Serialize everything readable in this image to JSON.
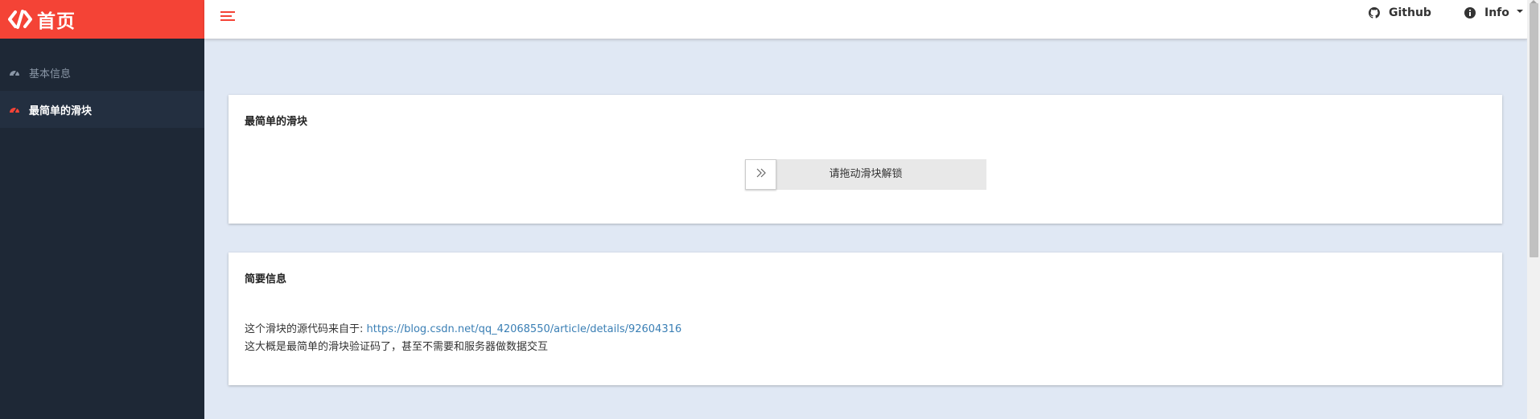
{
  "brand": {
    "title": "首页",
    "color": "#f44336"
  },
  "sidebar": {
    "items": [
      {
        "label": "基本信息",
        "icon": "dashboard-icon",
        "active": false
      },
      {
        "label": "最简单的滑块",
        "icon": "dashboard-icon",
        "active": true
      }
    ]
  },
  "topbar": {
    "menu_icon": "hamburger-icon",
    "github_label": "Github",
    "info_label": "Info"
  },
  "slider_card": {
    "title": "最简单的滑块",
    "slider_text": "请拖动滑块解锁",
    "handle_icon": "double-chevron-right-icon"
  },
  "info_card": {
    "title": "简要信息",
    "source_prefix": "这个滑块的源代码来自于: ",
    "source_url": "https://blog.csdn.net/qq_42068550/article/details/92604316",
    "description": "这大概是最简单的滑块验证码了，甚至不需要和服务器做数据交互"
  }
}
